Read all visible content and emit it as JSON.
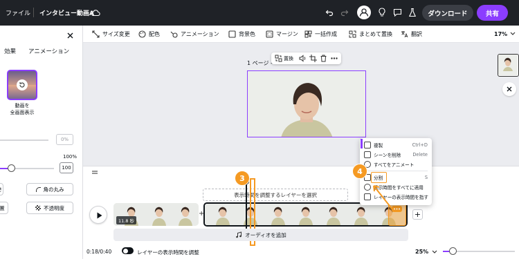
{
  "topbar": {
    "file_label": "ファイル",
    "doc_title": "インタビュー動画A",
    "download_label": "ダウンロード",
    "share_label": "共有"
  },
  "toolbar": {
    "items": [
      {
        "label": "サイズ変更",
        "icon": "resize-icon"
      },
      {
        "label": "配色",
        "icon": "palette-icon"
      },
      {
        "label": "アニメーション",
        "icon": "animation-icon"
      },
      {
        "label": "背景色",
        "icon": "square-icon"
      },
      {
        "label": "マージン",
        "icon": "margin-icon"
      },
      {
        "label": "一括作成",
        "icon": "bulk-create-icon"
      },
      {
        "label": "まとめて置換",
        "icon": "replace-all-icon"
      },
      {
        "label": "翻訳",
        "icon": "translate-icon"
      }
    ],
    "zoom": "17%"
  },
  "left_panel": {
    "tabs": [
      "効果",
      "アニメーション"
    ],
    "tile_label_1": "動画を",
    "tile_label_2": "全画面表示",
    "slider1_value": "0%",
    "pct_100": "100%",
    "slider2_value": "100",
    "corner_label": "角の丸み",
    "opacity_label": "不透明度",
    "partial_btn_1": "さ",
    "partial_btn_2": "置"
  },
  "canvas": {
    "page_label": "1 ページ -",
    "element_toolbar": {
      "replace_label": "置換"
    }
  },
  "timeline": {
    "adjust_layer_label": "表示時間を調整するレイヤーを選択",
    "clip_duration": "11.8 秒",
    "add_audio_label": "オーディオを追加",
    "time_position": "0:18/0:40",
    "toggle_label": "レイヤーの表示時間を調整",
    "zoom": "25%"
  },
  "context_menu": {
    "items": [
      {
        "label": "複製",
        "shortcut": "Ctrl+D"
      },
      {
        "label": "シーンを削除",
        "shortcut": "Delete"
      },
      {
        "label": "すべてをアニメート",
        "shortcut": ""
      },
      {
        "label": "分割",
        "shortcut": "S"
      },
      {
        "label": "表示時間をすべてに適用",
        "shortcut": ""
      },
      {
        "label": "レイヤーの表示時間を指す",
        "shortcut": ""
      }
    ]
  },
  "annotations": {
    "step3": "3",
    "step4": "4"
  },
  "colors": {
    "topbar_bg": "#1f2227",
    "accent_purple": "#8b3dff",
    "annotation_orange": "#f59a23"
  }
}
